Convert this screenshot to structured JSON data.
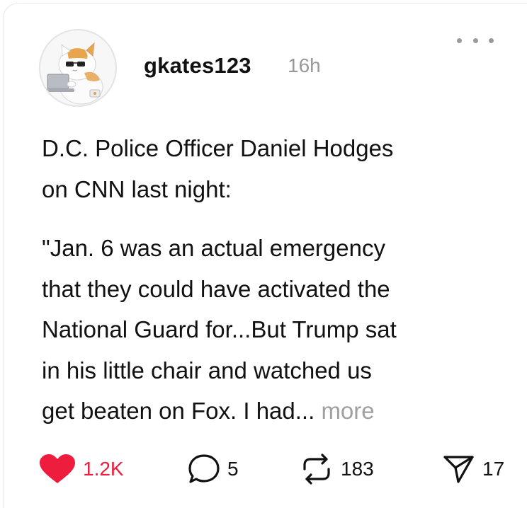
{
  "post": {
    "username": "gkates123",
    "time": "16h",
    "paragraph1_lines": [
      "D.C. Police Officer Daniel Hodges",
      "on CNN last night:"
    ],
    "paragraph2_lines": [
      "\"Jan. 6 was an actual emergency",
      "that they could have activated the",
      "National Guard for...But Trump sat",
      "in his little chair and watched us"
    ],
    "paragraph2_last": "get beaten on Fox. I had... ",
    "more_label": "more"
  },
  "actions": {
    "likes": "1.2K",
    "replies": "5",
    "reposts": "183",
    "shares": "17"
  },
  "colors": {
    "like_red": "#ee1c3d",
    "muted_gray": "#999999"
  },
  "icons": {
    "menu": "more-icon",
    "like": "heart-icon",
    "reply": "comment-icon",
    "repost": "repost-icon",
    "share": "send-icon"
  }
}
